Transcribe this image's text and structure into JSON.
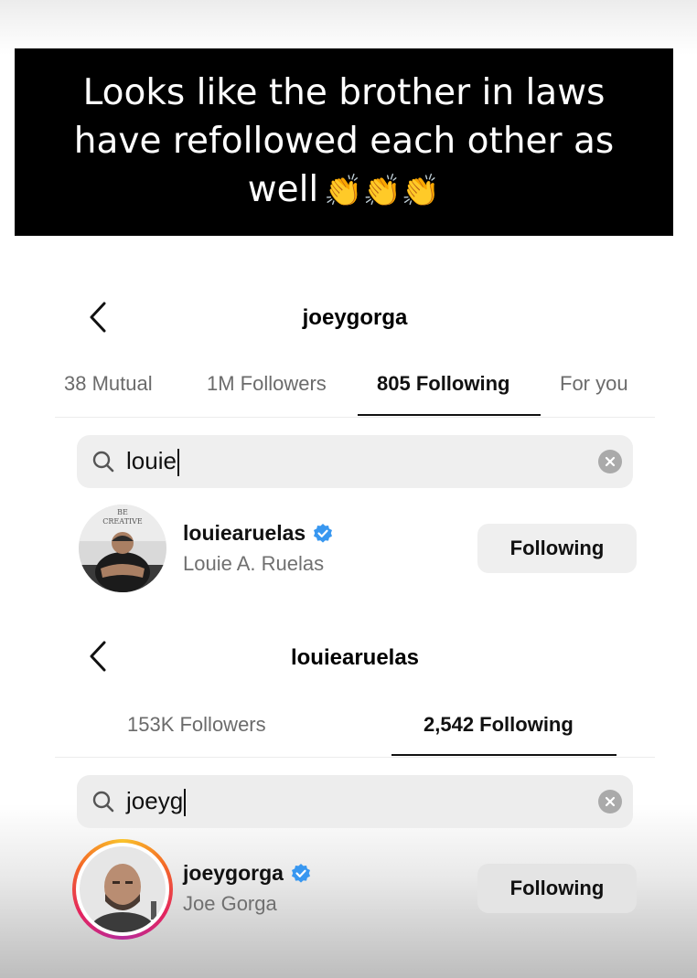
{
  "caption": {
    "lines": [
      "Looks like the brother in laws",
      "have refollowed each other as",
      "well"
    ],
    "emoji": "👏👏👏"
  },
  "screen1": {
    "title": "joeygorga",
    "tabs": [
      "38 Mutual",
      "1M Followers",
      "805 Following",
      "For you"
    ],
    "active_tab": "805 Following",
    "search_value": "louie",
    "result": {
      "username": "louiearuelas",
      "full_name": "Louie A. Ruelas",
      "verified": true,
      "button_label": "Following",
      "avatar_text": [
        "BE",
        "CREATIVE"
      ]
    }
  },
  "screen2": {
    "title": "louiearuelas",
    "tabs": [
      "153K Followers",
      "2,542 Following"
    ],
    "active_tab": "2,542 Following",
    "search_value": "joeyg",
    "result": {
      "username": "joeygorga",
      "full_name": "Joe Gorga",
      "verified": true,
      "has_story_ring": true,
      "button_label": "Following"
    }
  },
  "colors": {
    "verified_blue": "#3897f0",
    "button_bg": "#efefef",
    "search_bg": "#efefef",
    "muted_text": "#6b6b6b"
  },
  "icons": [
    "chevron-left-icon",
    "search-icon",
    "clear-icon",
    "verified-badge-icon"
  ]
}
